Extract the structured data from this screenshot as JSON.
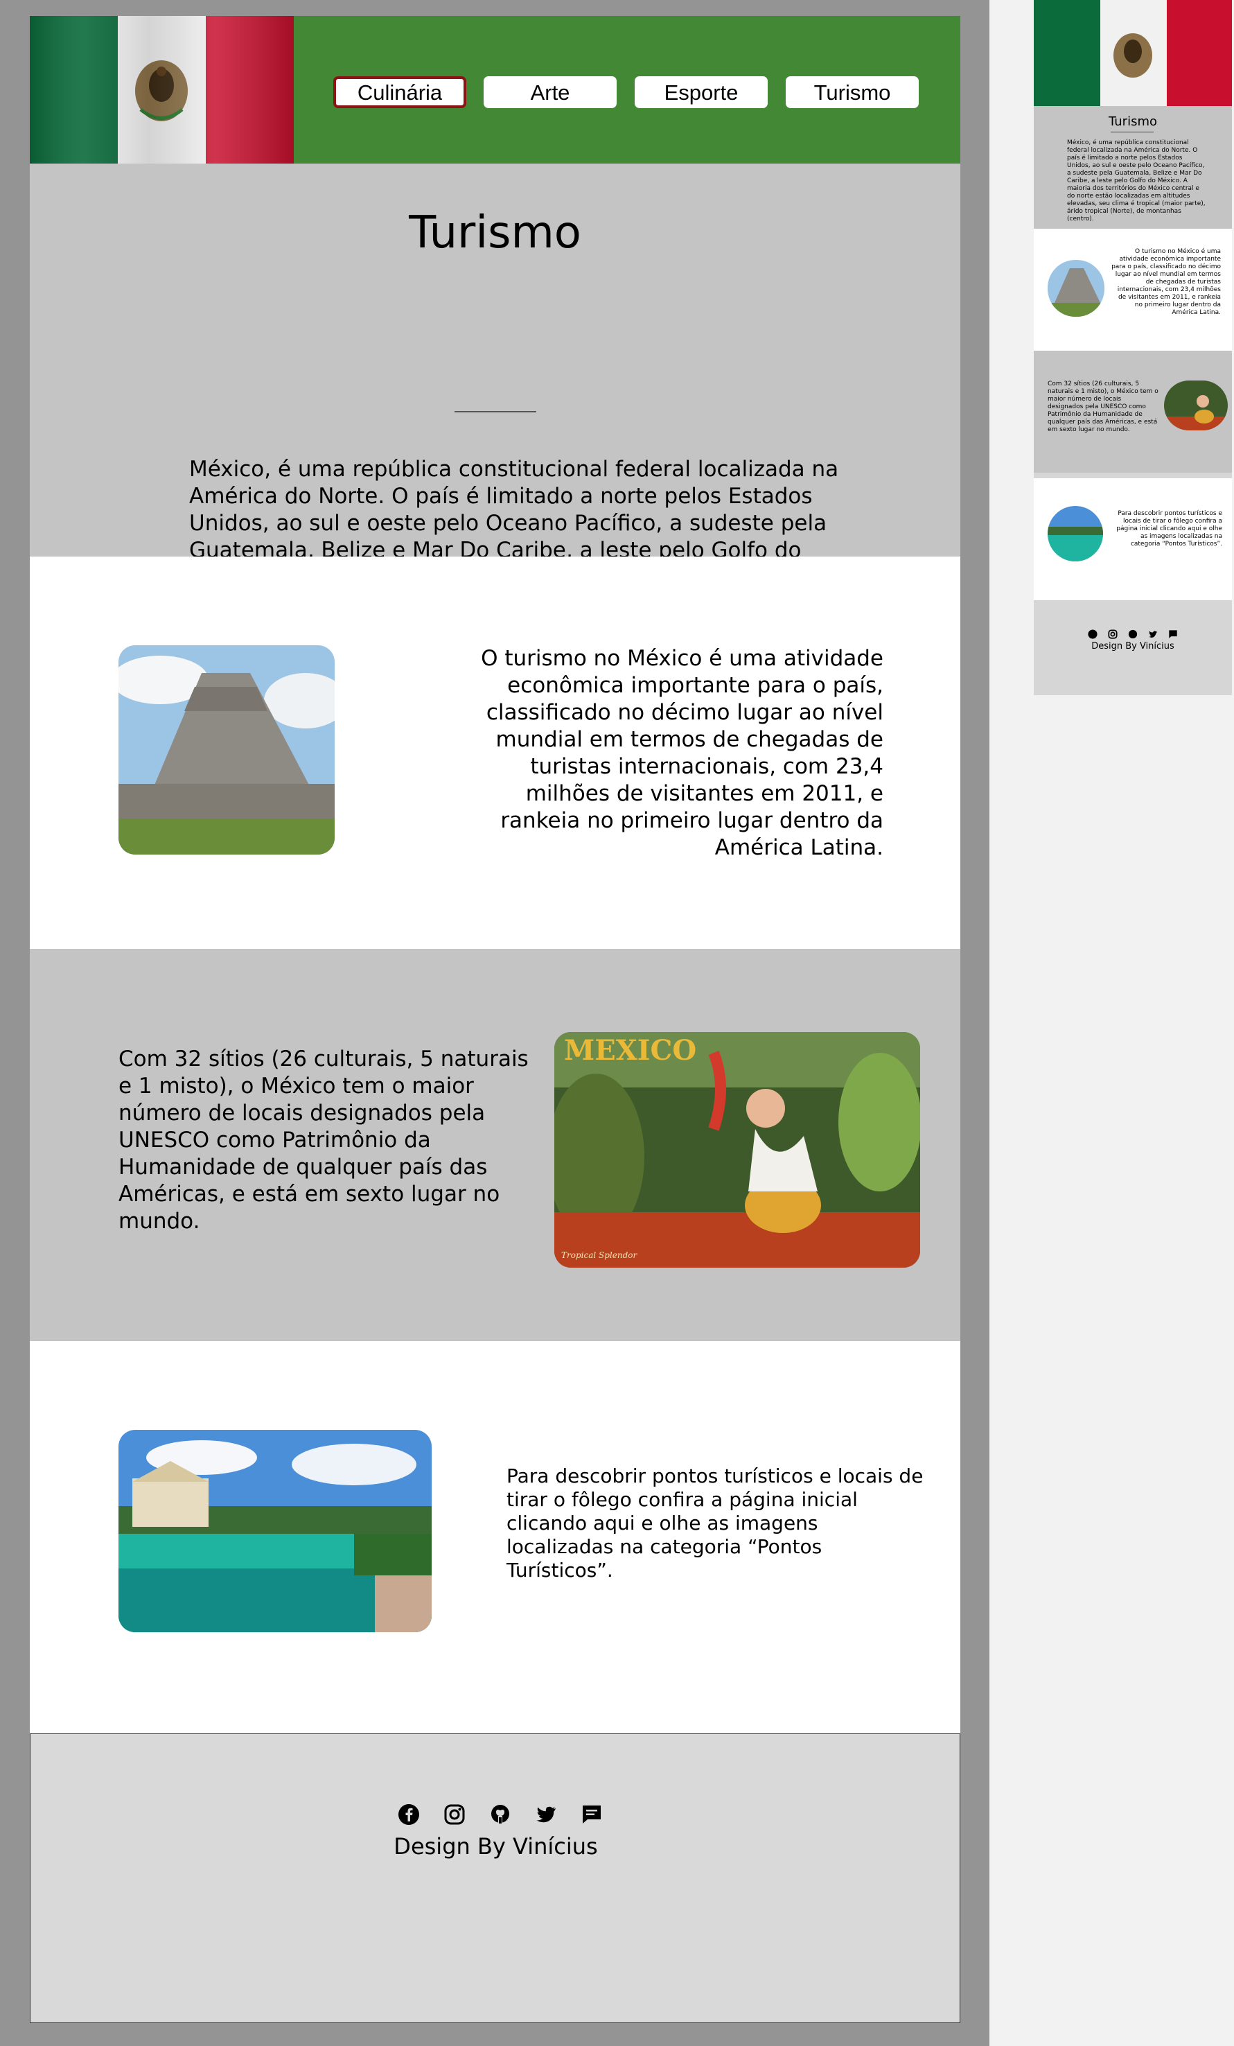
{
  "nav": {
    "items": [
      {
        "label": "Culinária",
        "active": true
      },
      {
        "label": "Arte",
        "active": false
      },
      {
        "label": "Esporte",
        "active": false
      },
      {
        "label": "Turismo",
        "active": false
      }
    ]
  },
  "hero": {
    "title": "Turismo",
    "intro": "México, é uma república constitucional federal localizada na América do Norte. O país é limitado a norte pelos Estados Unidos, ao sul e oeste pelo Oceano Pacífico, a sudeste pela Guatemala, Belize e Mar Do Caribe, a leste pelo Golfo do México. A maioria dos territórios do México central e do norte estão localizadas em altitudes elevadas, seu clima é tropical (maior parte), árido tropical (Norte), de montanhas (centro)."
  },
  "sections": [
    {
      "text": "O turismo no México é uma atividade econômica importante para o país, classificado no décimo lugar ao nível mundial em termos de chegadas de turistas internacionais, com 23,4 milhões de visitantes em 2011, e rankeia no primeiro lugar dentro da América Latina."
    },
    {
      "text": "Com 32 sítios (26 culturais, 5 naturais e 1 misto), o México tem o maior número de locais designados pela UNESCO como Patrimônio da Humanidade de qualquer país das Américas, e está em sexto lugar no mundo."
    },
    {
      "text": "Para descobrir pontos turísticos e locais de tirar o fôlego confira a página inicial clicando aqui e olhe as imagens localizadas na categoria “Pontos Turísticos”."
    }
  ],
  "poster": {
    "headline": "MEXICO",
    "caption": "Tropical Splendor"
  },
  "footer": {
    "credit": "Design By Vinícius",
    "icons": [
      "facebook-icon",
      "instagram-icon",
      "github-icon",
      "twitter-icon",
      "chat-icon"
    ]
  },
  "colors": {
    "header_green": "#438935",
    "active_border": "#8b1414",
    "section_grey": "#c4c4c4",
    "footer_grey": "#d9d9d9",
    "artboard_grey": "#949494"
  }
}
